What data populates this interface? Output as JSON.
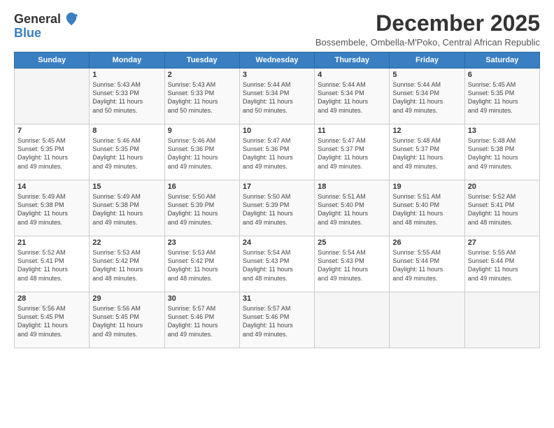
{
  "logo": {
    "general": "General",
    "blue": "Blue"
  },
  "header": {
    "month": "December 2025",
    "location": "Bossembele, Ombella-M'Poko, Central African Republic"
  },
  "days_of_week": [
    "Sunday",
    "Monday",
    "Tuesday",
    "Wednesday",
    "Thursday",
    "Friday",
    "Saturday"
  ],
  "weeks": [
    [
      {
        "day": "",
        "info": ""
      },
      {
        "day": "1",
        "info": "Sunrise: 5:43 AM\nSunset: 5:33 PM\nDaylight: 11 hours\nand 50 minutes."
      },
      {
        "day": "2",
        "info": "Sunrise: 5:43 AM\nSunset: 5:33 PM\nDaylight: 11 hours\nand 50 minutes."
      },
      {
        "day": "3",
        "info": "Sunrise: 5:44 AM\nSunset: 5:34 PM\nDaylight: 11 hours\nand 50 minutes."
      },
      {
        "day": "4",
        "info": "Sunrise: 5:44 AM\nSunset: 5:34 PM\nDaylight: 11 hours\nand 49 minutes."
      },
      {
        "day": "5",
        "info": "Sunrise: 5:44 AM\nSunset: 5:34 PM\nDaylight: 11 hours\nand 49 minutes."
      },
      {
        "day": "6",
        "info": "Sunrise: 5:45 AM\nSunset: 5:35 PM\nDaylight: 11 hours\nand 49 minutes."
      }
    ],
    [
      {
        "day": "7",
        "info": "Sunrise: 5:45 AM\nSunset: 5:35 PM\nDaylight: 11 hours\nand 49 minutes."
      },
      {
        "day": "8",
        "info": "Sunrise: 5:46 AM\nSunset: 5:35 PM\nDaylight: 11 hours\nand 49 minutes."
      },
      {
        "day": "9",
        "info": "Sunrise: 5:46 AM\nSunset: 5:36 PM\nDaylight: 11 hours\nand 49 minutes."
      },
      {
        "day": "10",
        "info": "Sunrise: 5:47 AM\nSunset: 5:36 PM\nDaylight: 11 hours\nand 49 minutes."
      },
      {
        "day": "11",
        "info": "Sunrise: 5:47 AM\nSunset: 5:37 PM\nDaylight: 11 hours\nand 49 minutes."
      },
      {
        "day": "12",
        "info": "Sunrise: 5:48 AM\nSunset: 5:37 PM\nDaylight: 11 hours\nand 49 minutes."
      },
      {
        "day": "13",
        "info": "Sunrise: 5:48 AM\nSunset: 5:38 PM\nDaylight: 11 hours\nand 49 minutes."
      }
    ],
    [
      {
        "day": "14",
        "info": "Sunrise: 5:49 AM\nSunset: 5:38 PM\nDaylight: 11 hours\nand 49 minutes."
      },
      {
        "day": "15",
        "info": "Sunrise: 5:49 AM\nSunset: 5:38 PM\nDaylight: 11 hours\nand 49 minutes."
      },
      {
        "day": "16",
        "info": "Sunrise: 5:50 AM\nSunset: 5:39 PM\nDaylight: 11 hours\nand 49 minutes."
      },
      {
        "day": "17",
        "info": "Sunrise: 5:50 AM\nSunset: 5:39 PM\nDaylight: 11 hours\nand 49 minutes."
      },
      {
        "day": "18",
        "info": "Sunrise: 5:51 AM\nSunset: 5:40 PM\nDaylight: 11 hours\nand 49 minutes."
      },
      {
        "day": "19",
        "info": "Sunrise: 5:51 AM\nSunset: 5:40 PM\nDaylight: 11 hours\nand 48 minutes."
      },
      {
        "day": "20",
        "info": "Sunrise: 5:52 AM\nSunset: 5:41 PM\nDaylight: 11 hours\nand 48 minutes."
      }
    ],
    [
      {
        "day": "21",
        "info": "Sunrise: 5:52 AM\nSunset: 5:41 PM\nDaylight: 11 hours\nand 48 minutes."
      },
      {
        "day": "22",
        "info": "Sunrise: 5:53 AM\nSunset: 5:42 PM\nDaylight: 11 hours\nand 48 minutes."
      },
      {
        "day": "23",
        "info": "Sunrise: 5:53 AM\nSunset: 5:42 PM\nDaylight: 11 hours\nand 48 minutes."
      },
      {
        "day": "24",
        "info": "Sunrise: 5:54 AM\nSunset: 5:43 PM\nDaylight: 11 hours\nand 48 minutes."
      },
      {
        "day": "25",
        "info": "Sunrise: 5:54 AM\nSunset: 5:43 PM\nDaylight: 11 hours\nand 49 minutes."
      },
      {
        "day": "26",
        "info": "Sunrise: 5:55 AM\nSunset: 5:44 PM\nDaylight: 11 hours\nand 49 minutes."
      },
      {
        "day": "27",
        "info": "Sunrise: 5:55 AM\nSunset: 5:44 PM\nDaylight: 11 hours\nand 49 minutes."
      }
    ],
    [
      {
        "day": "28",
        "info": "Sunrise: 5:56 AM\nSunset: 5:45 PM\nDaylight: 11 hours\nand 49 minutes."
      },
      {
        "day": "29",
        "info": "Sunrise: 5:56 AM\nSunset: 5:45 PM\nDaylight: 11 hours\nand 49 minutes."
      },
      {
        "day": "30",
        "info": "Sunrise: 5:57 AM\nSunset: 5:46 PM\nDaylight: 11 hours\nand 49 minutes."
      },
      {
        "day": "31",
        "info": "Sunrise: 5:57 AM\nSunset: 5:46 PM\nDaylight: 11 hours\nand 49 minutes."
      },
      {
        "day": "",
        "info": ""
      },
      {
        "day": "",
        "info": ""
      },
      {
        "day": "",
        "info": ""
      }
    ]
  ]
}
